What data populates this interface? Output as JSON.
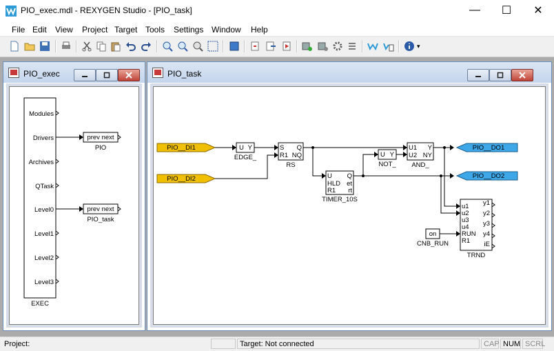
{
  "window": {
    "title": "PIO_exec.mdl - REXYGEN Studio - [PIO_task]",
    "minimize_glyph": "—",
    "maximize_glyph": "☐",
    "close_glyph": "✕"
  },
  "menu": [
    "File",
    "Edit",
    "View",
    "Project",
    "Target",
    "Tools",
    "Settings",
    "Window",
    "Help"
  ],
  "toolbar": {
    "icons": [
      "new-icon",
      "open-icon",
      "save-icon",
      "print-icon",
      "cut-icon",
      "copy-icon",
      "paste-icon",
      "undo-icon",
      "redo-icon",
      "zoom-in-icon",
      "zoom-out-icon",
      "zoom-fit-icon",
      "select-icon",
      "compile-icon",
      "download-icon",
      "upload-icon",
      "run-icon",
      "block-new-icon",
      "block-params-icon",
      "settings-icon",
      "list-icon",
      "watch-icon",
      "watch-list-icon",
      "info-icon"
    ],
    "info_dropdown_glyph": "▾"
  },
  "windows": {
    "exec": {
      "title": "PIO_exec",
      "block": {
        "name": "EXEC",
        "outputs": [
          "Modules",
          "Drivers",
          "Archives",
          "QTask",
          "Level0",
          "Level1",
          "Level2",
          "Level3"
        ]
      },
      "links": [
        {
          "from": "Drivers",
          "block": "PIO",
          "ports": "prev  next"
        },
        {
          "from": "Level0",
          "block": "PIO_task",
          "ports": "prev  next"
        }
      ]
    },
    "task": {
      "title": "PIO_task",
      "inputs": [
        {
          "name": "PIO__DI1",
          "color": "#f0c000"
        },
        {
          "name": "PIO__DI2",
          "color": "#f0c000"
        }
      ],
      "outputs": [
        {
          "name": "PIO__DO1",
          "color": "#3da7e8"
        },
        {
          "name": "PIO__DO2",
          "color": "#3da7e8"
        }
      ],
      "blocks": {
        "edge": {
          "name": "EDGE_",
          "ports_in": "U",
          "ports_out": "Y"
        },
        "rs": {
          "name": "RS",
          "in": [
            "S",
            "R1"
          ],
          "out": [
            "Q",
            "NQ"
          ]
        },
        "not": {
          "name": "NOT_",
          "ports_in": "U",
          "ports_out": "Y"
        },
        "and": {
          "name": "AND_",
          "in": [
            "U1",
            "U2"
          ],
          "out": [
            "Y",
            "NY"
          ]
        },
        "timer": {
          "name": "TIMER_10S",
          "in": [
            "U",
            "HLD",
            "R1"
          ],
          "out": [
            "Q",
            "et",
            "rt"
          ]
        },
        "trnd": {
          "name": "TRND",
          "in": [
            "u1",
            "u2",
            "u3",
            "u4",
            "RUN",
            "R1"
          ],
          "out": [
            "y1",
            "y2",
            "y3",
            "y4",
            "iE"
          ]
        },
        "cnb": {
          "name": "CNB_RUN",
          "value": "on"
        }
      }
    }
  },
  "status": {
    "project": "Project:",
    "target": "Target: Not connected",
    "cap": "CAP",
    "num": "NUM",
    "scrl": "SCRL"
  },
  "colors": {
    "input_tag": "#f0c000",
    "output_tag": "#3da7e8",
    "title_gradient_top": "#dbe6f4"
  }
}
